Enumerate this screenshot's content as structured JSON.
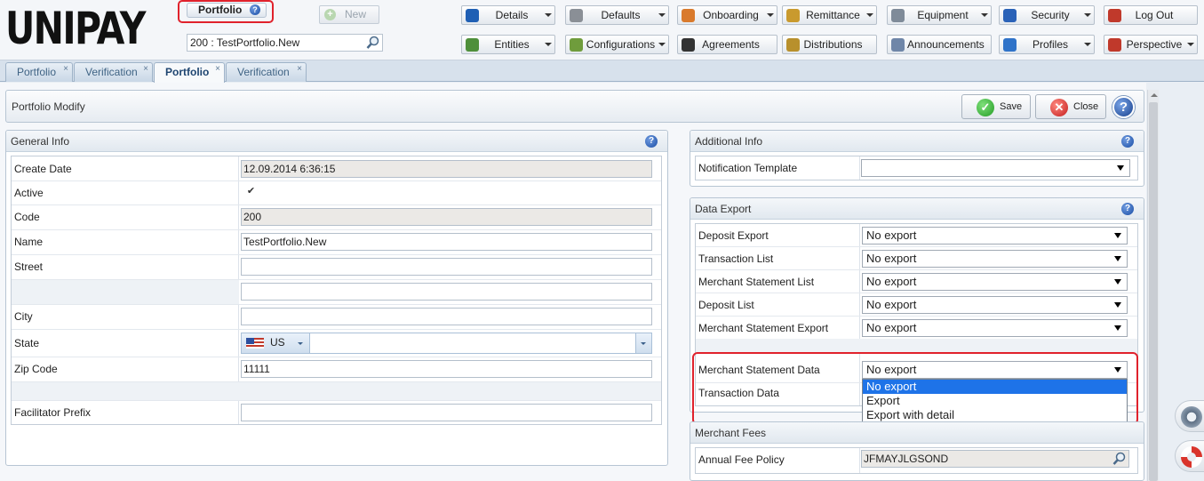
{
  "app": {
    "logo": "UNIPAY"
  },
  "header": {
    "current_tab_label": "Portfolio",
    "new_button": "New",
    "search_value": "200 : TestPortfolio.New"
  },
  "toolbar": {
    "row1": [
      {
        "label": "Details",
        "icon": "info-icon",
        "color": "#1f5fb4",
        "dropdown": true
      },
      {
        "label": "Defaults",
        "icon": "gear-icon",
        "color": "#8a8f96",
        "dropdown": true
      },
      {
        "label": "Onboarding",
        "icon": "onboarding-icon",
        "color": "#d97a2c",
        "dropdown": true
      },
      {
        "label": "Remittance",
        "icon": "coins-icon",
        "color": "#c99a2e",
        "dropdown": true
      },
      {
        "label": "Equipment",
        "icon": "equipment-icon",
        "color": "#7f8b99",
        "dropdown": true
      },
      {
        "label": "Security",
        "icon": "shield-icon",
        "color": "#2a62b8",
        "dropdown": true
      },
      {
        "label": "Log Out",
        "icon": "logout-icon",
        "color": "#c0392b",
        "dropdown": false
      }
    ],
    "row2": [
      {
        "label": "Entities",
        "icon": "pie-icon",
        "color": "#4e8f3a",
        "dropdown": true
      },
      {
        "label": "Configurations",
        "icon": "config-icon",
        "color": "#6f9c3c",
        "dropdown": true
      },
      {
        "label": "Agreements",
        "icon": "handshake-icon",
        "color": "#333333",
        "dropdown": false
      },
      {
        "label": "Distributions",
        "icon": "distribution-icon",
        "color": "#b8902c",
        "dropdown": false
      },
      {
        "label": "Announcements",
        "icon": "mail-icon",
        "color": "#6f86a8",
        "dropdown": false
      },
      {
        "label": "Profiles",
        "icon": "profile-icon",
        "color": "#2f73c9",
        "dropdown": true
      },
      {
        "label": "Perspective",
        "icon": "tools-icon",
        "color": "#c0392b",
        "dropdown": true
      }
    ]
  },
  "tabs": [
    {
      "label": "Portfolio",
      "active": false
    },
    {
      "label": "Verification",
      "active": false
    },
    {
      "label": "Portfolio",
      "active": true
    },
    {
      "label": "Verification",
      "active": false
    }
  ],
  "tab_close": "×",
  "page": {
    "title": "Portfolio Modify",
    "save": "Save",
    "close": "Close",
    "help": "?"
  },
  "general": {
    "title": "General Info",
    "create_date_label": "Create Date",
    "create_date": "12.09.2014 6:36:15",
    "active_label": "Active",
    "active_mark": "✔",
    "code_label": "Code",
    "code": "200",
    "name_label": "Name",
    "name": "TestPortfolio.New",
    "street_label": "Street",
    "street": "",
    "street2": "",
    "city_label": "City",
    "city": "",
    "state_label": "State",
    "state_country": "US",
    "state_value": "",
    "zip_label": "Zip Code",
    "zip": "11111",
    "facilitator_label": "Facilitator Prefix",
    "facilitator": ""
  },
  "additional": {
    "title": "Additional Info",
    "notification_label": "Notification Template",
    "notification_value": ""
  },
  "export": {
    "title": "Data Export",
    "rows": [
      {
        "label": "Deposit Export",
        "value": "No export"
      },
      {
        "label": "Transaction List",
        "value": "No export"
      },
      {
        "label": "Merchant Statement List",
        "value": "No export"
      },
      {
        "label": "Deposit List",
        "value": "No export"
      },
      {
        "label": "Merchant Statement Export",
        "value": "No export"
      }
    ],
    "msd_label": "Merchant Statement Data",
    "msd_value": "No export",
    "td_label": "Transaction Data",
    "options": [
      "No export",
      "Export",
      "Export with detail"
    ],
    "selected_index": 0
  },
  "fees": {
    "title": "Merchant Fees",
    "annual_label": "Annual Fee Policy",
    "annual_value": "JFMAYJLGSOND"
  }
}
